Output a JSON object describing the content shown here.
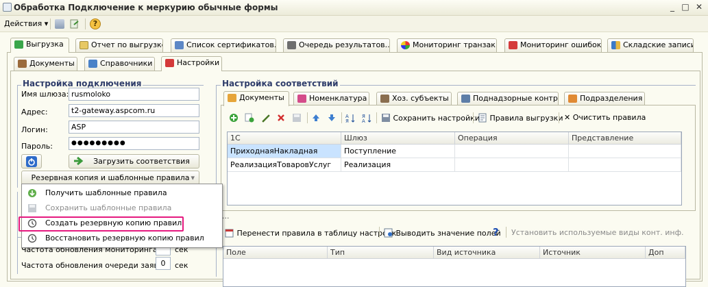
{
  "window": {
    "title": "Обработка  Подключение к меркурию обычные формы",
    "minimize": "_",
    "maximize": "□",
    "close": "✕"
  },
  "toolbar": {
    "actions_label": "Действия",
    "help": "?"
  },
  "main_tabs": [
    {
      "label": "Выгрузка"
    },
    {
      "label": "Отчет по выгрузке"
    },
    {
      "label": "Список сертификатов..."
    },
    {
      "label": "Очередь результатов..."
    },
    {
      "label": "Мониторинг транзак..."
    },
    {
      "label": "Мониторинг ошибок"
    },
    {
      "label": "Складские записи"
    }
  ],
  "sub_tabs": [
    {
      "label": "Документы"
    },
    {
      "label": "Справочники"
    },
    {
      "label": "Настройки"
    }
  ],
  "connection": {
    "title": "Настройка подключения",
    "gateway_label": "Имя шлюза:",
    "gateway_value": "rusmoloko",
    "address_label": "Адрес:",
    "address_value": "t2-gateway.aspcom.ru",
    "login_label": "Логин:",
    "login_value": "ASP",
    "password_label": "Пароль:",
    "password_value": "●●●●●●●●●",
    "load_button": "Загрузить соответствия",
    "backup_dropdown": "Резервная копия и шаблонные правила"
  },
  "menu": {
    "items": [
      {
        "label": "Получить шаблонные правила"
      },
      {
        "label": "Сохранить шаблонные правила"
      },
      {
        "label": "Создать резервную копию правил"
      },
      {
        "label": "Восстановить резервную копию правил"
      }
    ]
  },
  "frequency": {
    "monitoring_label": "Частота обновления мониторинга:",
    "monitoring_unit": "сек",
    "queue_label": "Частота обновления очереди заявок:",
    "queue_value": "0",
    "queue_unit": "сек"
  },
  "mapping": {
    "title": "Настройка соответствий",
    "tabs": [
      {
        "label": "Документы"
      },
      {
        "label": "Номенклатура"
      },
      {
        "label": "Хоз. субъекты"
      },
      {
        "label": "Поднадзорные контр."
      },
      {
        "label": "Подразделения"
      }
    ],
    "toolbar": {
      "save_settings": "Сохранить настройки",
      "export_rules": "Правила выгрузки",
      "clear_rules": "Очистить правила"
    },
    "columns": [
      "1С",
      "Шлюз",
      "Операция",
      "Представление"
    ],
    "rows": [
      [
        "ПриходнаяНакладная",
        "Поступление",
        "",
        ""
      ],
      [
        "РеализацияТоваровУслуг",
        "Реализация",
        "",
        ""
      ]
    ],
    "ellipsis": "...",
    "bottom_toolbar": {
      "move_rules": "Перенести правила в таблицу настроек",
      "show_fields": "Выводить значение полей",
      "help": "?",
      "set_kinds": "Установить используемые виды конт. инф."
    },
    "field_columns": [
      "Поле",
      "Тип",
      "Вид источника",
      "Источник",
      "Доп"
    ]
  },
  "colors": {
    "highlight": "#e5197f",
    "selected_row": "#c9e3ff",
    "group_title": "#2f3d6b"
  }
}
